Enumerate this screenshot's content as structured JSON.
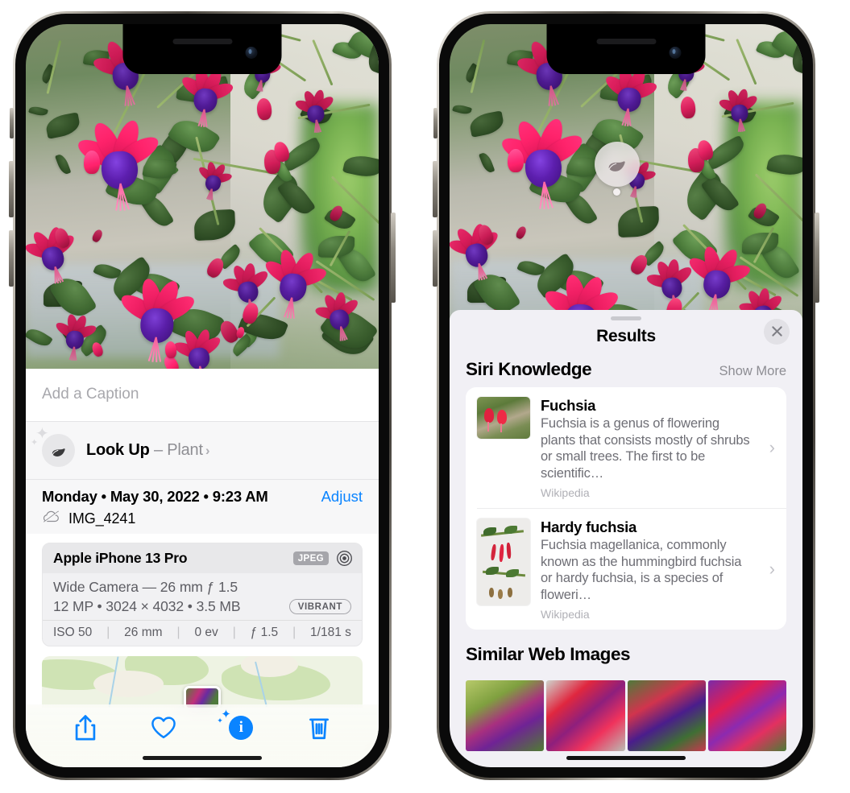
{
  "left_phone": {
    "photo": {
      "alt_description": "Fuchsia flowers hanging basket"
    },
    "caption_field": {
      "placeholder": "Add a Caption",
      "value": ""
    },
    "look_up": {
      "icon": "leaf-icon",
      "label": "Look Up",
      "dash": " – ",
      "subject": "Plant",
      "chevron": "›"
    },
    "metadata": {
      "date_line": "Monday • May 30, 2022 • 9:23 AM",
      "adjust_label": "Adjust",
      "cloud_icon": "cloud-slash-icon",
      "file_name": "IMG_4241"
    },
    "exif": {
      "device": "Apple iPhone 13 Pro",
      "format_tag": "JPEG",
      "lens_icon": "camera-lens-icon",
      "lens_line": "Wide Camera — 26 mm ƒ 1.5",
      "spec_line": "12 MP • 3024 × 4032 • 3.5 MB",
      "profile_tag": "VIBRANT",
      "settings": [
        {
          "label": "ISO 50"
        },
        {
          "label": "26 mm"
        },
        {
          "label": "0 ev"
        },
        {
          "label": "ƒ 1.5"
        },
        {
          "label": "1/181 s"
        }
      ],
      "separator": "|"
    },
    "map": {
      "pin_label": "photo-location-pin"
    },
    "toolbar": [
      {
        "name": "share-button",
        "icon": "share-icon"
      },
      {
        "name": "favorite-button",
        "icon": "heart-icon"
      },
      {
        "name": "info-button",
        "icon": "info-sparkle-icon",
        "glyph": "i"
      },
      {
        "name": "delete-button",
        "icon": "trash-icon"
      }
    ]
  },
  "right_phone": {
    "photo": {
      "alt_description": "Fuchsia flowers hanging basket"
    },
    "visual_lookup_badge": {
      "icon": "leaf-icon"
    },
    "sheet": {
      "grabber": true,
      "title": "Results",
      "close_icon": "close-icon",
      "sections": [
        {
          "title": "Siri Knowledge",
          "action_label": "Show More",
          "items": [
            {
              "title": "Fuchsia",
              "description": "Fuchsia is a genus of flowering plants that consists mostly of shrubs or small trees. The first to be scientific…",
              "source": "Wikipedia",
              "chevron": "›",
              "thumbnail": "fuchsia-red-flowers-thumb"
            },
            {
              "title": "Hardy fuchsia",
              "description": "Fuchsia magellanica, commonly known as the hummingbird fuchsia or hardy fuchsia, is a species of floweri…",
              "source": "Wikipedia",
              "chevron": "›",
              "thumbnail": "hardy-fuchsia-specimen-thumb"
            }
          ]
        },
        {
          "title": "Similar Web Images",
          "images": [
            {
              "name": "web-image-1"
            },
            {
              "name": "web-image-2"
            },
            {
              "name": "web-image-3"
            },
            {
              "name": "web-image-4"
            }
          ]
        }
      ]
    }
  },
  "colors": {
    "accent_blue": "#0a84ff",
    "sheet_background": "#f1f0f5",
    "card_white": "#ffffff",
    "secondary_text": "#8e8e93",
    "exif_background": "#f1f1f3"
  }
}
